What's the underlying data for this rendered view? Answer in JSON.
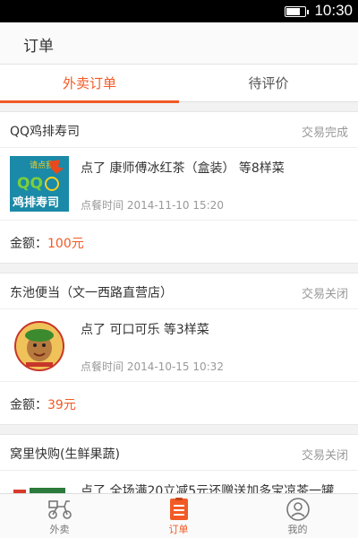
{
  "status_bar": {
    "time": "10:30",
    "battery_level": 0.75
  },
  "header": {
    "title": "订单"
  },
  "tabs": [
    {
      "label": "外卖订单",
      "active": true
    },
    {
      "label": "待评价",
      "active": false
    }
  ],
  "orders": [
    {
      "shop": "QQ鸡排寿司",
      "status": "交易完成",
      "description": "点了 康师傅冰红茶（盒装） 等8样菜",
      "order_time": "点餐时间 2014-11-10 15:20",
      "amount_label": "金额：",
      "amount": "100元",
      "thumb_text": [
        "请点我",
        "QQ",
        "鸡排寿司"
      ]
    },
    {
      "shop": "东池便当（文一西路直营店）",
      "status": "交易关闭",
      "description": "点了 可口可乐 等3样菜",
      "order_time": "点餐时间 2014-10-15 10:32",
      "amount_label": "金额：",
      "amount": "39元"
    },
    {
      "shop": "窝里快购(生鲜果蔬)",
      "status": "交易关闭",
      "description": "点了 全场满20立减5元还赠送加多宝凉茶一罐"
    }
  ],
  "bottom_nav": [
    {
      "label": "外卖",
      "icon": "scooter-icon",
      "active": false
    },
    {
      "label": "订单",
      "icon": "order-list-icon",
      "active": true
    },
    {
      "label": "我的",
      "icon": "profile-icon",
      "active": false
    }
  ],
  "colors": {
    "accent": "#f25a25",
    "muted": "#999999",
    "background": "#f2f2f2"
  }
}
